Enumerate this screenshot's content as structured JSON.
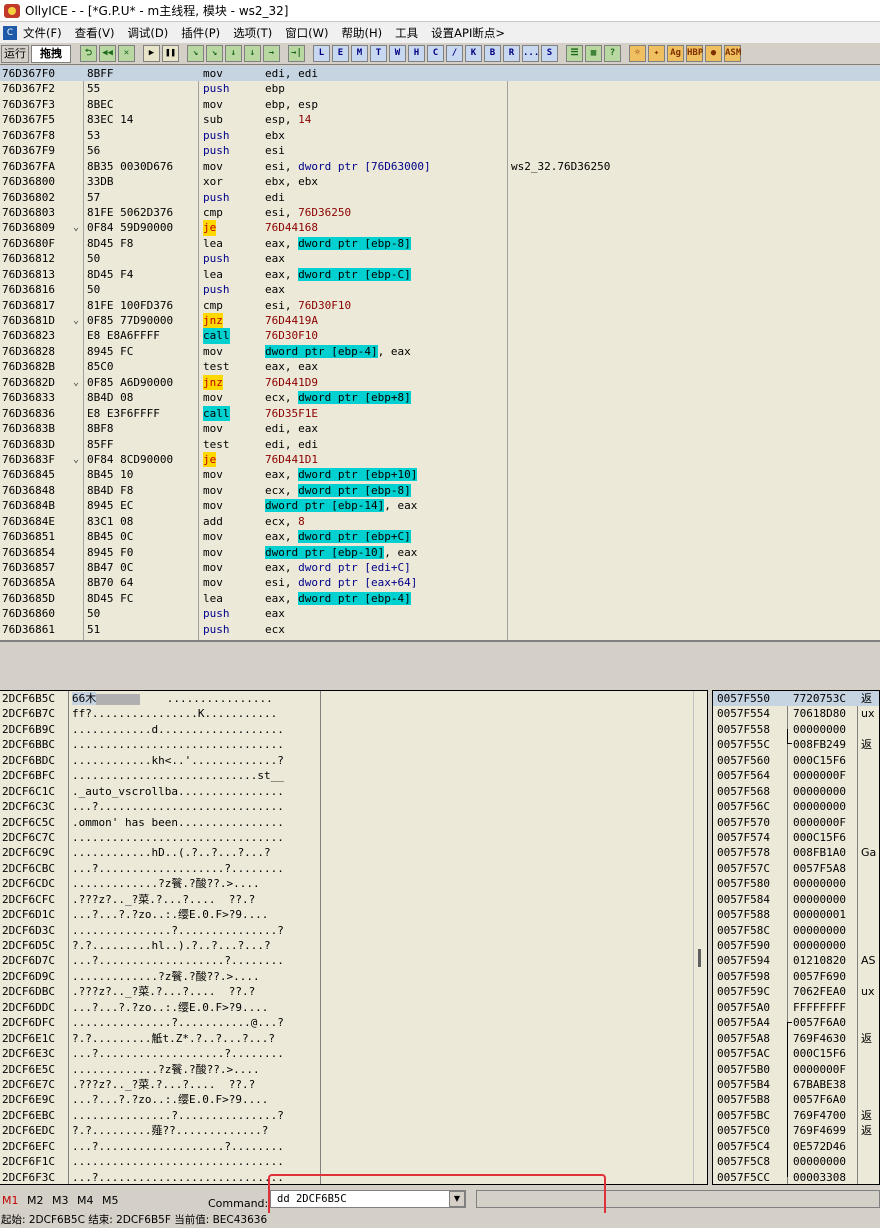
{
  "window": {
    "title": "OllyICE - - [*G.P.U* - m主线程, 模块 - ws2_32]"
  },
  "menu": {
    "items": [
      "文件(F)",
      "查看(V)",
      "调试(D)",
      "插件(P)",
      "选项(T)",
      "窗口(W)",
      "帮助(H)",
      "工具",
      "设置API断点>"
    ]
  },
  "toolbar": {
    "status": "运行",
    "mode": "拖拽",
    "group1": [
      "⮌",
      "◀◀",
      "✕"
    ],
    "group2": [
      "▶",
      "❚❚"
    ],
    "group3": [
      "↘",
      "↘",
      "↓",
      "↓",
      "→"
    ],
    "group4": [
      "→|"
    ],
    "letters": [
      "L",
      "E",
      "M",
      "T",
      "W",
      "H",
      "C",
      "/",
      "K",
      "B",
      "R",
      "...",
      "S"
    ],
    "group5": [
      "☰",
      "▦",
      "?"
    ],
    "plugins": [
      "☼",
      "✦",
      "Ag",
      "HBP",
      "●",
      "ASM"
    ]
  },
  "cpu": {
    "rows": [
      {
        "addr": "76D367F0",
        "jmp": "",
        "hex": "8BFF",
        "mn": "mov",
        "mnType": "plain",
        "ops": [
          [
            "edi, edi",
            "plain"
          ]
        ],
        "cmt": "",
        "selected": true
      },
      {
        "addr": "76D367F2",
        "jmp": "",
        "hex": "55",
        "mn": "push",
        "mnType": "push",
        "ops": [
          [
            "ebp",
            "plain"
          ]
        ],
        "cmt": ""
      },
      {
        "addr": "76D367F3",
        "jmp": "",
        "hex": "8BEC",
        "mn": "mov",
        "mnType": "plain",
        "ops": [
          [
            "ebp, esp",
            "plain"
          ]
        ],
        "cmt": ""
      },
      {
        "addr": "76D367F5",
        "jmp": "",
        "hex": "83EC 14",
        "mn": "sub",
        "mnType": "plain",
        "ops": [
          [
            "esp, ",
            "plain"
          ],
          [
            "14",
            "imm"
          ]
        ],
        "cmt": ""
      },
      {
        "addr": "76D367F8",
        "jmp": "",
        "hex": "53",
        "mn": "push",
        "mnType": "push",
        "ops": [
          [
            "ebx",
            "plain"
          ]
        ],
        "cmt": ""
      },
      {
        "addr": "76D367F9",
        "jmp": "",
        "hex": "56",
        "mn": "push",
        "mnType": "push",
        "ops": [
          [
            "esi",
            "plain"
          ]
        ],
        "cmt": ""
      },
      {
        "addr": "76D367FA",
        "jmp": "",
        "hex": "8B35 0030D676",
        "mn": "mov",
        "mnType": "plain",
        "ops": [
          [
            "esi, ",
            "plain"
          ],
          [
            "dword ptr [76D63000]",
            "memplain"
          ]
        ],
        "cmt": "ws2_32.76D36250"
      },
      {
        "addr": "76D36800",
        "jmp": "",
        "hex": "33DB",
        "mn": "xor",
        "mnType": "plain",
        "ops": [
          [
            "ebx, ebx",
            "plain"
          ]
        ],
        "cmt": ""
      },
      {
        "addr": "76D36802",
        "jmp": "",
        "hex": "57",
        "mn": "push",
        "mnType": "push",
        "ops": [
          [
            "edi",
            "plain"
          ]
        ],
        "cmt": ""
      },
      {
        "addr": "76D36803",
        "jmp": "",
        "hex": "81FE 5062D376",
        "mn": "cmp",
        "mnType": "plain",
        "ops": [
          [
            "esi, ",
            "plain"
          ],
          [
            "76D36250",
            "imm"
          ]
        ],
        "cmt": ""
      },
      {
        "addr": "76D36809",
        "jmp": "⌄",
        "hex": "0F84 59D90000",
        "mn": "je",
        "mnType": "jcc",
        "ops": [
          [
            "76D44168",
            "imm"
          ]
        ],
        "cmt": ""
      },
      {
        "addr": "76D3680F",
        "jmp": "",
        "hex": "8D45 F8",
        "mn": "lea",
        "mnType": "plain",
        "ops": [
          [
            "eax, ",
            "plain"
          ],
          [
            "dword ptr [ebp-8]",
            "mem"
          ]
        ],
        "cmt": ""
      },
      {
        "addr": "76D36812",
        "jmp": "",
        "hex": "50",
        "mn": "push",
        "mnType": "push",
        "ops": [
          [
            "eax",
            "plain"
          ]
        ],
        "cmt": ""
      },
      {
        "addr": "76D36813",
        "jmp": "",
        "hex": "8D45 F4",
        "mn": "lea",
        "mnType": "plain",
        "ops": [
          [
            "eax, ",
            "plain"
          ],
          [
            "dword ptr [ebp-C]",
            "mem"
          ]
        ],
        "cmt": ""
      },
      {
        "addr": "76D36816",
        "jmp": "",
        "hex": "50",
        "mn": "push",
        "mnType": "push",
        "ops": [
          [
            "eax",
            "plain"
          ]
        ],
        "cmt": ""
      },
      {
        "addr": "76D36817",
        "jmp": "",
        "hex": "81FE 100FD376",
        "mn": "cmp",
        "mnType": "plain",
        "ops": [
          [
            "esi, ",
            "plain"
          ],
          [
            "76D30F10",
            "imm"
          ]
        ],
        "cmt": ""
      },
      {
        "addr": "76D3681D",
        "jmp": "⌄",
        "hex": "0F85 77D90000",
        "mn": "jnz",
        "mnType": "jcc",
        "ops": [
          [
            "76D4419A",
            "imm"
          ]
        ],
        "cmt": ""
      },
      {
        "addr": "76D36823",
        "jmp": "",
        "hex": "E8 E8A6FFFF",
        "mn": "call",
        "mnType": "call",
        "ops": [
          [
            "76D30F10",
            "imm"
          ]
        ],
        "cmt": ""
      },
      {
        "addr": "76D36828",
        "jmp": "",
        "hex": "8945 FC",
        "mn": "mov",
        "mnType": "plain",
        "ops": [
          [
            "dword ptr [ebp-4]",
            "mem"
          ],
          [
            ", eax",
            "plain"
          ]
        ],
        "cmt": ""
      },
      {
        "addr": "76D3682B",
        "jmp": "",
        "hex": "85C0",
        "mn": "test",
        "mnType": "plain",
        "ops": [
          [
            "eax, eax",
            "plain"
          ]
        ],
        "cmt": ""
      },
      {
        "addr": "76D3682D",
        "jmp": "⌄",
        "hex": "0F85 A6D90000",
        "mn": "jnz",
        "mnType": "jcc",
        "ops": [
          [
            "76D441D9",
            "imm"
          ]
        ],
        "cmt": ""
      },
      {
        "addr": "76D36833",
        "jmp": "",
        "hex": "8B4D 08",
        "mn": "mov",
        "mnType": "plain",
        "ops": [
          [
            "ecx, ",
            "plain"
          ],
          [
            "dword ptr [ebp+8]",
            "mem"
          ]
        ],
        "cmt": ""
      },
      {
        "addr": "76D36836",
        "jmp": "",
        "hex": "E8 E3F6FFFF",
        "mn": "call",
        "mnType": "call",
        "ops": [
          [
            "76D35F1E",
            "imm"
          ]
        ],
        "cmt": ""
      },
      {
        "addr": "76D3683B",
        "jmp": "",
        "hex": "8BF8",
        "mn": "mov",
        "mnType": "plain",
        "ops": [
          [
            "edi, eax",
            "plain"
          ]
        ],
        "cmt": ""
      },
      {
        "addr": "76D3683D",
        "jmp": "",
        "hex": "85FF",
        "mn": "test",
        "mnType": "plain",
        "ops": [
          [
            "edi, edi",
            "plain"
          ]
        ],
        "cmt": ""
      },
      {
        "addr": "76D3683F",
        "jmp": "⌄",
        "hex": "0F84 8CD90000",
        "mn": "je",
        "mnType": "jcc",
        "ops": [
          [
            "76D441D1",
            "imm"
          ]
        ],
        "cmt": ""
      },
      {
        "addr": "76D36845",
        "jmp": "",
        "hex": "8B45 10",
        "mn": "mov",
        "mnType": "plain",
        "ops": [
          [
            "eax, ",
            "plain"
          ],
          [
            "dword ptr [ebp+10]",
            "mem"
          ]
        ],
        "cmt": ""
      },
      {
        "addr": "76D36848",
        "jmp": "",
        "hex": "8B4D F8",
        "mn": "mov",
        "mnType": "plain",
        "ops": [
          [
            "ecx, ",
            "plain"
          ],
          [
            "dword ptr [ebp-8]",
            "mem"
          ]
        ],
        "cmt": ""
      },
      {
        "addr": "76D3684B",
        "jmp": "",
        "hex": "8945 EC",
        "mn": "mov",
        "mnType": "plain",
        "ops": [
          [
            "dword ptr [ebp-14]",
            "mem"
          ],
          [
            ", eax",
            "plain"
          ]
        ],
        "cmt": ""
      },
      {
        "addr": "76D3684E",
        "jmp": "",
        "hex": "83C1 08",
        "mn": "add",
        "mnType": "plain",
        "ops": [
          [
            "ecx, ",
            "plain"
          ],
          [
            "8",
            "imm"
          ]
        ],
        "cmt": ""
      },
      {
        "addr": "76D36851",
        "jmp": "",
        "hex": "8B45 0C",
        "mn": "mov",
        "mnType": "plain",
        "ops": [
          [
            "eax, ",
            "plain"
          ],
          [
            "dword ptr [ebp+C]",
            "mem"
          ]
        ],
        "cmt": ""
      },
      {
        "addr": "76D36854",
        "jmp": "",
        "hex": "8945 F0",
        "mn": "mov",
        "mnType": "plain",
        "ops": [
          [
            "dword ptr [ebp-10]",
            "mem"
          ],
          [
            ", eax",
            "plain"
          ]
        ],
        "cmt": ""
      },
      {
        "addr": "76D36857",
        "jmp": "",
        "hex": "8B47 0C",
        "mn": "mov",
        "mnType": "plain",
        "ops": [
          [
            "eax, ",
            "plain"
          ],
          [
            "dword ptr [edi+C]",
            "memplain"
          ]
        ],
        "cmt": ""
      },
      {
        "addr": "76D3685A",
        "jmp": "",
        "hex": "8B70 64",
        "mn": "mov",
        "mnType": "plain",
        "ops": [
          [
            "esi, ",
            "plain"
          ],
          [
            "dword ptr [eax+64]",
            "memplain"
          ]
        ],
        "cmt": ""
      },
      {
        "addr": "76D3685D",
        "jmp": "",
        "hex": "8D45 FC",
        "mn": "lea",
        "mnType": "plain",
        "ops": [
          [
            "eax, ",
            "plain"
          ],
          [
            "dword ptr [ebp-4]",
            "mem"
          ]
        ],
        "cmt": ""
      },
      {
        "addr": "76D36860",
        "jmp": "",
        "hex": "50",
        "mn": "push",
        "mnType": "push",
        "ops": [
          [
            "eax",
            "plain"
          ]
        ],
        "cmt": ""
      },
      {
        "addr": "76D36861",
        "jmp": "",
        "hex": "51",
        "mn": "push",
        "mnType": "push",
        "ops": [
          [
            "ecx",
            "plain"
          ]
        ],
        "cmt": ""
      }
    ]
  },
  "dump": {
    "rows": [
      {
        "addr": "2DCF6B5C",
        "sel": "66木",
        "ascii": "    ................"
      },
      {
        "addr": "2DCF6B7C",
        "sel": "",
        "ascii": "ff?................K..........."
      },
      {
        "addr": "2DCF6B9C",
        "sel": "",
        "ascii": "............d..................."
      },
      {
        "addr": "2DCF6BBC",
        "sel": "",
        "ascii": "................................"
      },
      {
        "addr": "2DCF6BDC",
        "sel": "",
        "ascii": "............kh<..'.............?"
      },
      {
        "addr": "2DCF6BFC",
        "sel": "",
        "ascii": "............................st__"
      },
      {
        "addr": "2DCF6C1C",
        "sel": "",
        "ascii": "._auto_vscrollba................"
      },
      {
        "addr": "2DCF6C3C",
        "sel": "",
        "ascii": "...?............................"
      },
      {
        "addr": "2DCF6C5C",
        "sel": "",
        "ascii": ".ommon' has been................"
      },
      {
        "addr": "2DCF6C7C",
        "sel": "",
        "ascii": "................................"
      },
      {
        "addr": "2DCF6C9C",
        "sel": "",
        "ascii": "............hD..(.?..?...?...?"
      },
      {
        "addr": "2DCF6CBC",
        "sel": "",
        "ascii": "...?...................?........"
      },
      {
        "addr": "2DCF6CDC",
        "sel": "",
        "ascii": ".............?z餮.?酸??.>...."
      },
      {
        "addr": "2DCF6CFC",
        "sel": "",
        "ascii": ".???z?.._?菜.?...?....  ??.?"
      },
      {
        "addr": "2DCF6D1C",
        "sel": "",
        "ascii": "...?...?.?zo..:.缨E.0.F>?9...."
      },
      {
        "addr": "2DCF6D3C",
        "sel": "",
        "ascii": "...............?...............?"
      },
      {
        "addr": "2DCF6D5C",
        "sel": "",
        "ascii": "?.?.........hl..).?..?...?...?"
      },
      {
        "addr": "2DCF6D7C",
        "sel": "",
        "ascii": "...?...................?........"
      },
      {
        "addr": "2DCF6D9C",
        "sel": "",
        "ascii": ".............?z餮.?酸??.>...."
      },
      {
        "addr": "2DCF6DBC",
        "sel": "",
        "ascii": ".???z?.._?菜.?...?....  ??.?"
      },
      {
        "addr": "2DCF6DDC",
        "sel": "",
        "ascii": "...?...?.?zo..:.缨E.0.F>?9...."
      },
      {
        "addr": "2DCF6DFC",
        "sel": "",
        "ascii": "...............?...........@...?"
      },
      {
        "addr": "2DCF6E1C",
        "sel": "",
        "ascii": "?.?.........觝t.Z*.?..?...?...?"
      },
      {
        "addr": "2DCF6E3C",
        "sel": "",
        "ascii": "...?...................?........"
      },
      {
        "addr": "2DCF6E5C",
        "sel": "",
        "ascii": ".............?z餮.?酸??.>...."
      },
      {
        "addr": "2DCF6E7C",
        "sel": "",
        "ascii": ".???z?.._?菜.?...?....  ??.?"
      },
      {
        "addr": "2DCF6E9C",
        "sel": "",
        "ascii": "...?...?.?zo..:.缨E.0.F>?9...."
      },
      {
        "addr": "2DCF6EBC",
        "sel": "",
        "ascii": "...............?...............?"
      },
      {
        "addr": "2DCF6EDC",
        "sel": "",
        "ascii": "?.?.........薤??.............?"
      },
      {
        "addr": "2DCF6EFC",
        "sel": "",
        "ascii": "...?...................?........"
      },
      {
        "addr": "2DCF6F1C",
        "sel": "",
        "ascii": "................................"
      },
      {
        "addr": "2DCF6F3C",
        "sel": "",
        "ascii": "...?............................"
      }
    ]
  },
  "stack": {
    "rows": [
      {
        "addr": "0057F550",
        "val": "7720753C",
        "cmt": "返",
        "sel": true
      },
      {
        "addr": "0057F554",
        "val": "70618D80",
        "cmt": "ux"
      },
      {
        "addr": "0057F558",
        "val": "00000000",
        "cmt": ""
      },
      {
        "addr": "0057F55C",
        "val": "008FB249",
        "cmt": "返"
      },
      {
        "addr": "0057F560",
        "val": "000C15F6",
        "cmt": ""
      },
      {
        "addr": "0057F564",
        "val": "0000000F",
        "cmt": ""
      },
      {
        "addr": "0057F568",
        "val": "00000000",
        "cmt": ""
      },
      {
        "addr": "0057F56C",
        "val": "00000000",
        "cmt": ""
      },
      {
        "addr": "0057F570",
        "val": "0000000F",
        "cmt": ""
      },
      {
        "addr": "0057F574",
        "val": "000C15F6",
        "cmt": ""
      },
      {
        "addr": "0057F578",
        "val": "008FB1A0",
        "cmt": "Ga"
      },
      {
        "addr": "0057F57C",
        "val": "0057F5A8",
        "cmt": ""
      },
      {
        "addr": "0057F580",
        "val": "00000000",
        "cmt": ""
      },
      {
        "addr": "0057F584",
        "val": "00000000",
        "cmt": ""
      },
      {
        "addr": "0057F588",
        "val": "00000001",
        "cmt": ""
      },
      {
        "addr": "0057F58C",
        "val": "00000000",
        "cmt": ""
      },
      {
        "addr": "0057F590",
        "val": "00000000",
        "cmt": ""
      },
      {
        "addr": "0057F594",
        "val": "01210820",
        "cmt": "AS"
      },
      {
        "addr": "0057F598",
        "val": "0057F690",
        "cmt": ""
      },
      {
        "addr": "0057F59C",
        "val": "7062FEA0",
        "cmt": "ux"
      },
      {
        "addr": "0057F5A0",
        "val": "FFFFFFFF",
        "cmt": ""
      },
      {
        "addr": "0057F5A4",
        "val": "0057F6A0",
        "cmt": ""
      },
      {
        "addr": "0057F5A8",
        "val": "769F4630",
        "cmt": "返"
      },
      {
        "addr": "0057F5AC",
        "val": "000C15F6",
        "cmt": ""
      },
      {
        "addr": "0057F5B0",
        "val": "0000000F",
        "cmt": ""
      },
      {
        "addr": "0057F5B4",
        "val": "67BABE38",
        "cmt": ""
      },
      {
        "addr": "0057F5B8",
        "val": "0057F6A0",
        "cmt": ""
      },
      {
        "addr": "0057F5BC",
        "val": "769F4700",
        "cmt": "返"
      },
      {
        "addr": "0057F5C0",
        "val": "769F4699",
        "cmt": "返"
      },
      {
        "addr": "0057F5C4",
        "val": "0E572D46",
        "cmt": ""
      },
      {
        "addr": "0057F5C8",
        "val": "00000000",
        "cmt": ""
      },
      {
        "addr": "0057F5CC",
        "val": "00003308",
        "cmt": ""
      }
    ]
  },
  "cmdbar": {
    "tabs": [
      "M1",
      "M2",
      "M3",
      "M4",
      "M5"
    ],
    "label": "Command:",
    "value": "dd 2DCF6B5C"
  },
  "status": {
    "text": "起始: 2DCF6B5C 结束: 2DCF6B5F 当前值: BEC43636"
  }
}
